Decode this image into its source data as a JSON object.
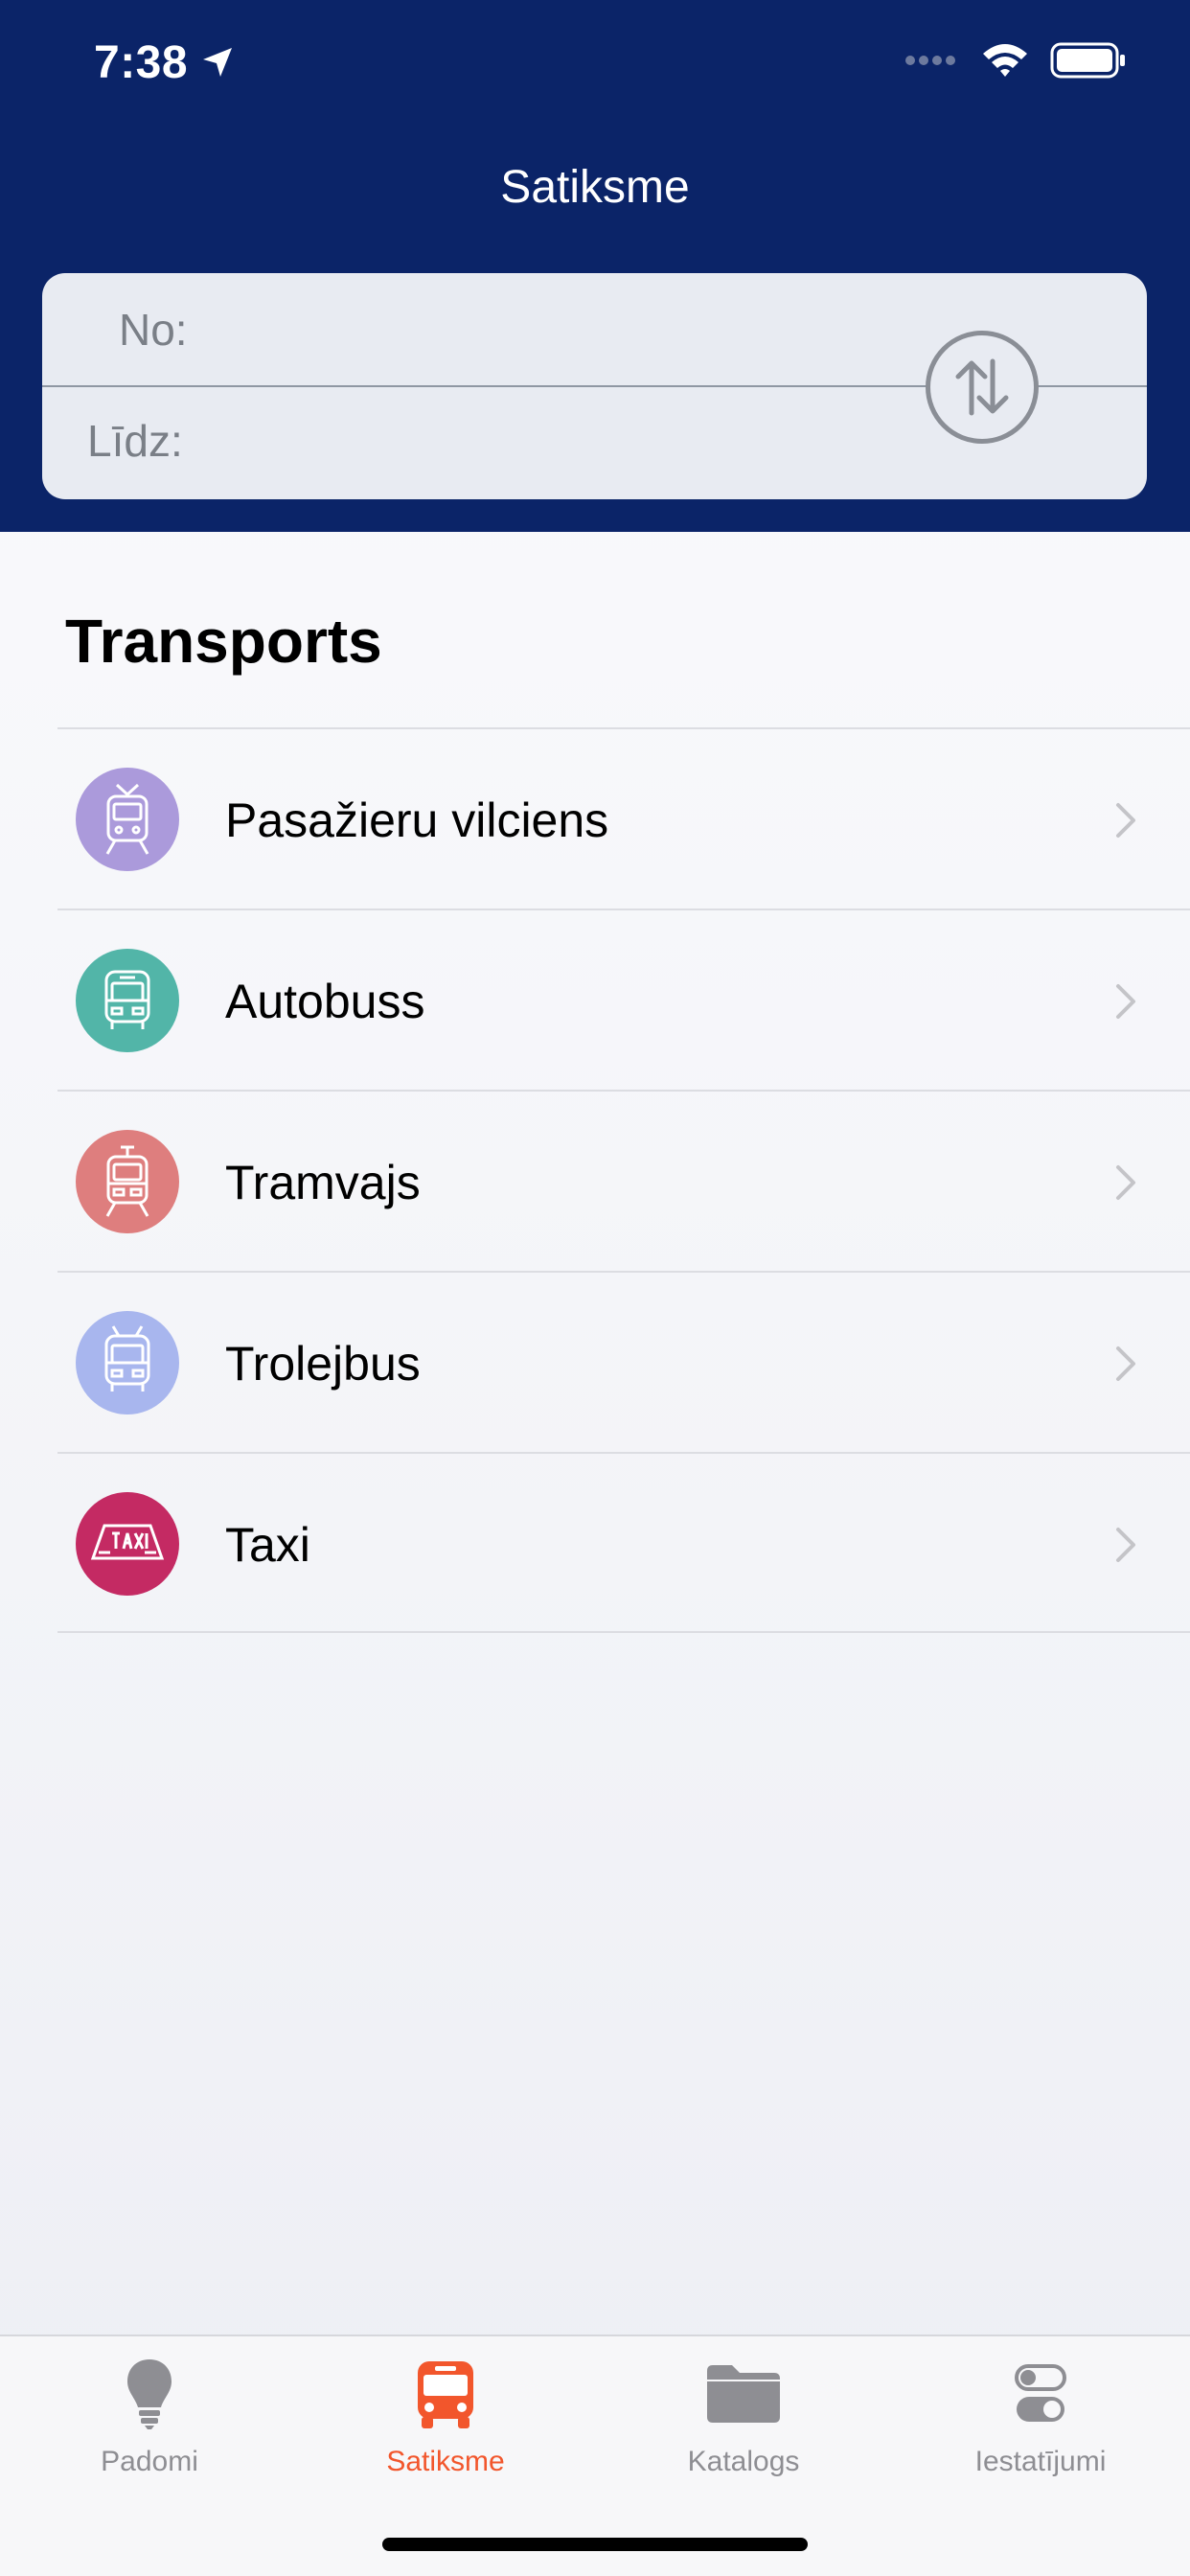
{
  "status": {
    "time": "7:38"
  },
  "header": {
    "title": "Satiksme"
  },
  "route": {
    "from_label": "No:",
    "to_label": "Līdz:"
  },
  "section": {
    "title": "Transports"
  },
  "transport_items": [
    {
      "label": "Pasažieru vilciens",
      "icon": "train-icon",
      "color": "#ab9adb"
    },
    {
      "label": "Autobuss",
      "icon": "bus-icon",
      "color": "#52b5a8"
    },
    {
      "label": "Tramvajs",
      "icon": "tram-icon",
      "color": "#de7e7e"
    },
    {
      "label": "Trolejbus",
      "icon": "trolleybus-icon",
      "color": "#a8b6ee"
    },
    {
      "label": "Taxi",
      "icon": "taxi-icon",
      "color": "#c42a63"
    }
  ],
  "tabs": [
    {
      "label": "Padomi",
      "icon": "lightbulb-icon",
      "active": false
    },
    {
      "label": "Satiksme",
      "icon": "bus-icon",
      "active": true
    },
    {
      "label": "Katalogs",
      "icon": "folder-icon",
      "active": false
    },
    {
      "label": "Iestatījumi",
      "icon": "toggle-icon",
      "active": false
    }
  ],
  "colors": {
    "header_bg": "#0b2468",
    "accent": "#f2562c"
  }
}
